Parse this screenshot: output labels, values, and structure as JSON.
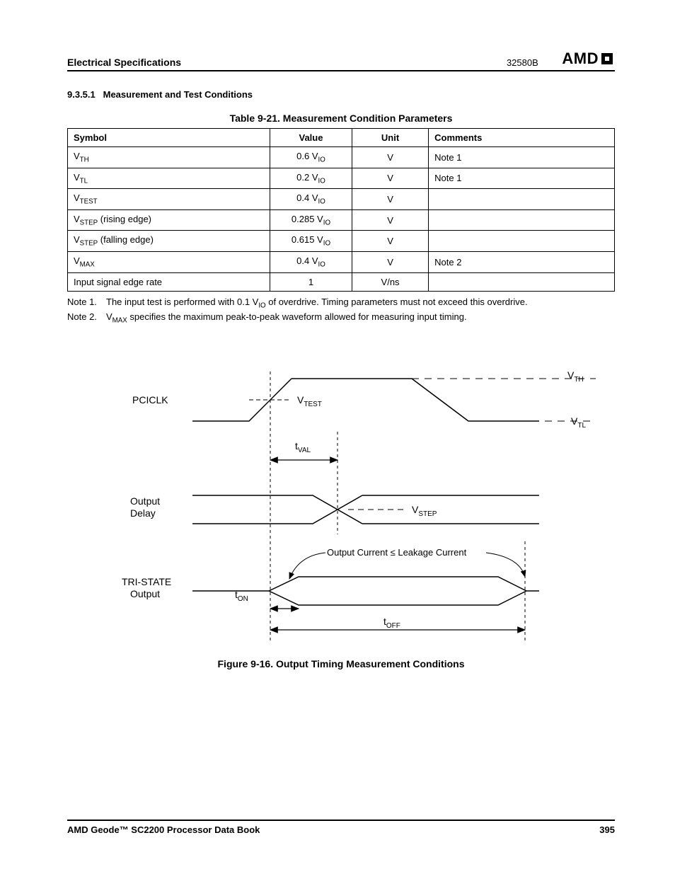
{
  "header": {
    "section_title": "Electrical Specifications",
    "doc_code": "32580B",
    "logo_text": "AMD"
  },
  "section": {
    "number": "9.3.5.1",
    "title": "Measurement and Test Conditions"
  },
  "table": {
    "title": "Table 9-21.  Measurement Condition Parameters",
    "headers": [
      "Symbol",
      "Value",
      "Unit",
      "Comments"
    ],
    "rows": [
      {
        "symbol_base": "V",
        "symbol_sub": "TH",
        "symbol_suffix": "",
        "value_pre": "0.6 V",
        "value_sub": "IO",
        "unit": "V",
        "comments": "Note 1"
      },
      {
        "symbol_base": "V",
        "symbol_sub": "TL",
        "symbol_suffix": "",
        "value_pre": "0.2 V",
        "value_sub": "IO",
        "unit": "V",
        "comments": "Note 1"
      },
      {
        "symbol_base": "V",
        "symbol_sub": "TEST",
        "symbol_suffix": "",
        "value_pre": "0.4 V",
        "value_sub": "IO",
        "unit": "V",
        "comments": ""
      },
      {
        "symbol_base": "V",
        "symbol_sub": "STEP",
        "symbol_suffix": " (rising edge)",
        "value_pre": "0.285 V",
        "value_sub": "IO",
        "unit": "V",
        "comments": ""
      },
      {
        "symbol_base": "V",
        "symbol_sub": "STEP",
        "symbol_suffix": " (falling edge)",
        "value_pre": "0.615 V",
        "value_sub": "IO",
        "unit": "V",
        "comments": ""
      },
      {
        "symbol_base": "V",
        "symbol_sub": "MAX",
        "symbol_suffix": "",
        "value_pre": "0.4 V",
        "value_sub": "IO",
        "unit": "V",
        "comments": "Note 2"
      },
      {
        "symbol_base": "Input signal edge rate",
        "symbol_sub": "",
        "symbol_suffix": "",
        "value_pre": "1",
        "value_sub": "",
        "unit": "V/ns",
        "comments": ""
      }
    ]
  },
  "notes": {
    "n1_label": "Note 1.",
    "n1_a": "The input test is performed with 0.1 V",
    "n1_sub": "IO",
    "n1_b": " of overdrive. Timing parameters must not exceed this overdrive.",
    "n2_label": "Note 2.",
    "n2_a": "V",
    "n2_sub": "MAX",
    "n2_b": " specifies the maximum peak-to-peak waveform allowed for measuring input timing."
  },
  "figure": {
    "caption": "Figure 9-16.  Output Timing Measurement Conditions",
    "labels": {
      "pciclk": "PCICLK",
      "output_delay1": "Output",
      "output_delay2": "Delay",
      "tristate1": "TRI-STATE",
      "tristate2": "Output",
      "vth_base": "V",
      "vth_sub": "TH",
      "vtl_base": "V",
      "vtl_sub": "TL",
      "vtest_base": "V",
      "vtest_sub": "TEST",
      "vstep_base": "V",
      "vstep_sub": "STEP",
      "tval_base": "t",
      "tval_sub": "VAL",
      "ton_base": "t",
      "ton_sub": "ON",
      "toff_base": "t",
      "toff_sub": "OFF",
      "leak": "Output Current ≤ Leakage Current"
    }
  },
  "footer": {
    "left": "AMD Geode™ SC2200  Processor Data Book",
    "right": "395"
  }
}
